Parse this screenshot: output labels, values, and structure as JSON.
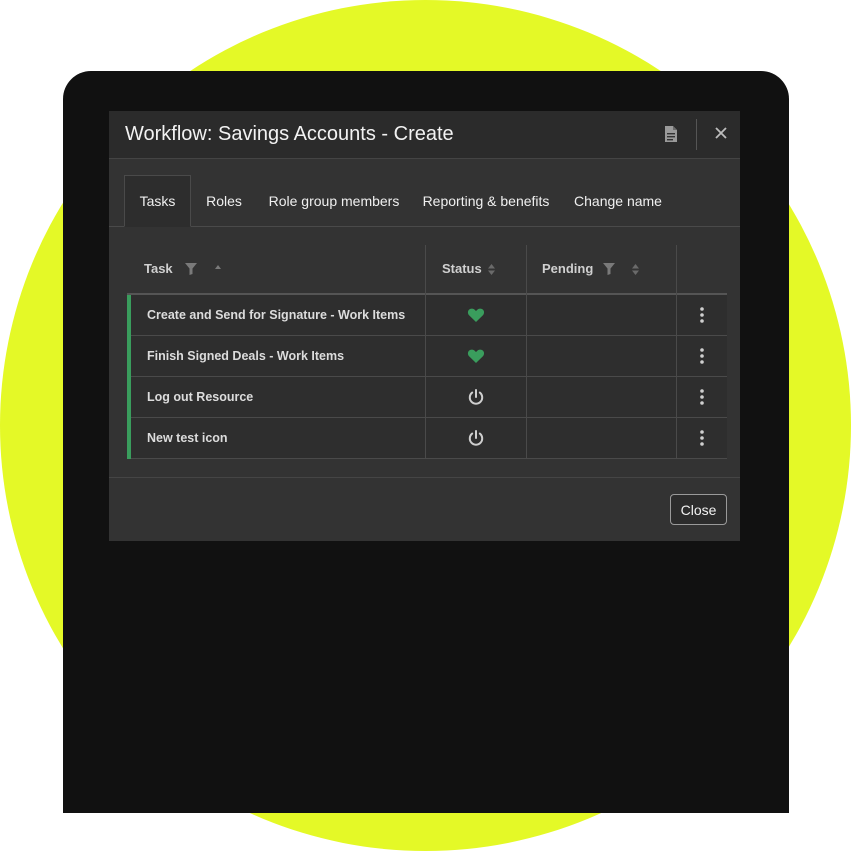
{
  "dialog": {
    "title": "Workflow: Savings Accounts - Create",
    "header_icons": [
      "document-icon",
      "close-icon"
    ]
  },
  "tabs": [
    {
      "label": "Tasks",
      "active": true
    },
    {
      "label": "Roles",
      "active": false
    },
    {
      "label": "Role group members",
      "active": false
    },
    {
      "label": "Reporting & benefits",
      "active": false
    },
    {
      "label": "Change name",
      "active": false
    }
  ],
  "grid": {
    "columns": {
      "task": "Task",
      "status": "Status",
      "pending": "Pending"
    },
    "rows": [
      {
        "task": "Create and Send for Signature - Work Items",
        "status_icon": "heart-icon",
        "pending": ""
      },
      {
        "task": "Finish Signed Deals - Work Items",
        "status_icon": "heart-icon",
        "pending": ""
      },
      {
        "task": "Log out Resource",
        "status_icon": "power-icon",
        "pending": ""
      },
      {
        "task": "New test icon",
        "status_icon": "power-icon",
        "pending": ""
      }
    ]
  },
  "footer": {
    "close_label": "Close"
  },
  "colors": {
    "background_accent": "#e4f927",
    "device": "#111111",
    "dialog": "#333333",
    "row_accent": "#3a9d5d",
    "heart": "#3a9d5d"
  }
}
